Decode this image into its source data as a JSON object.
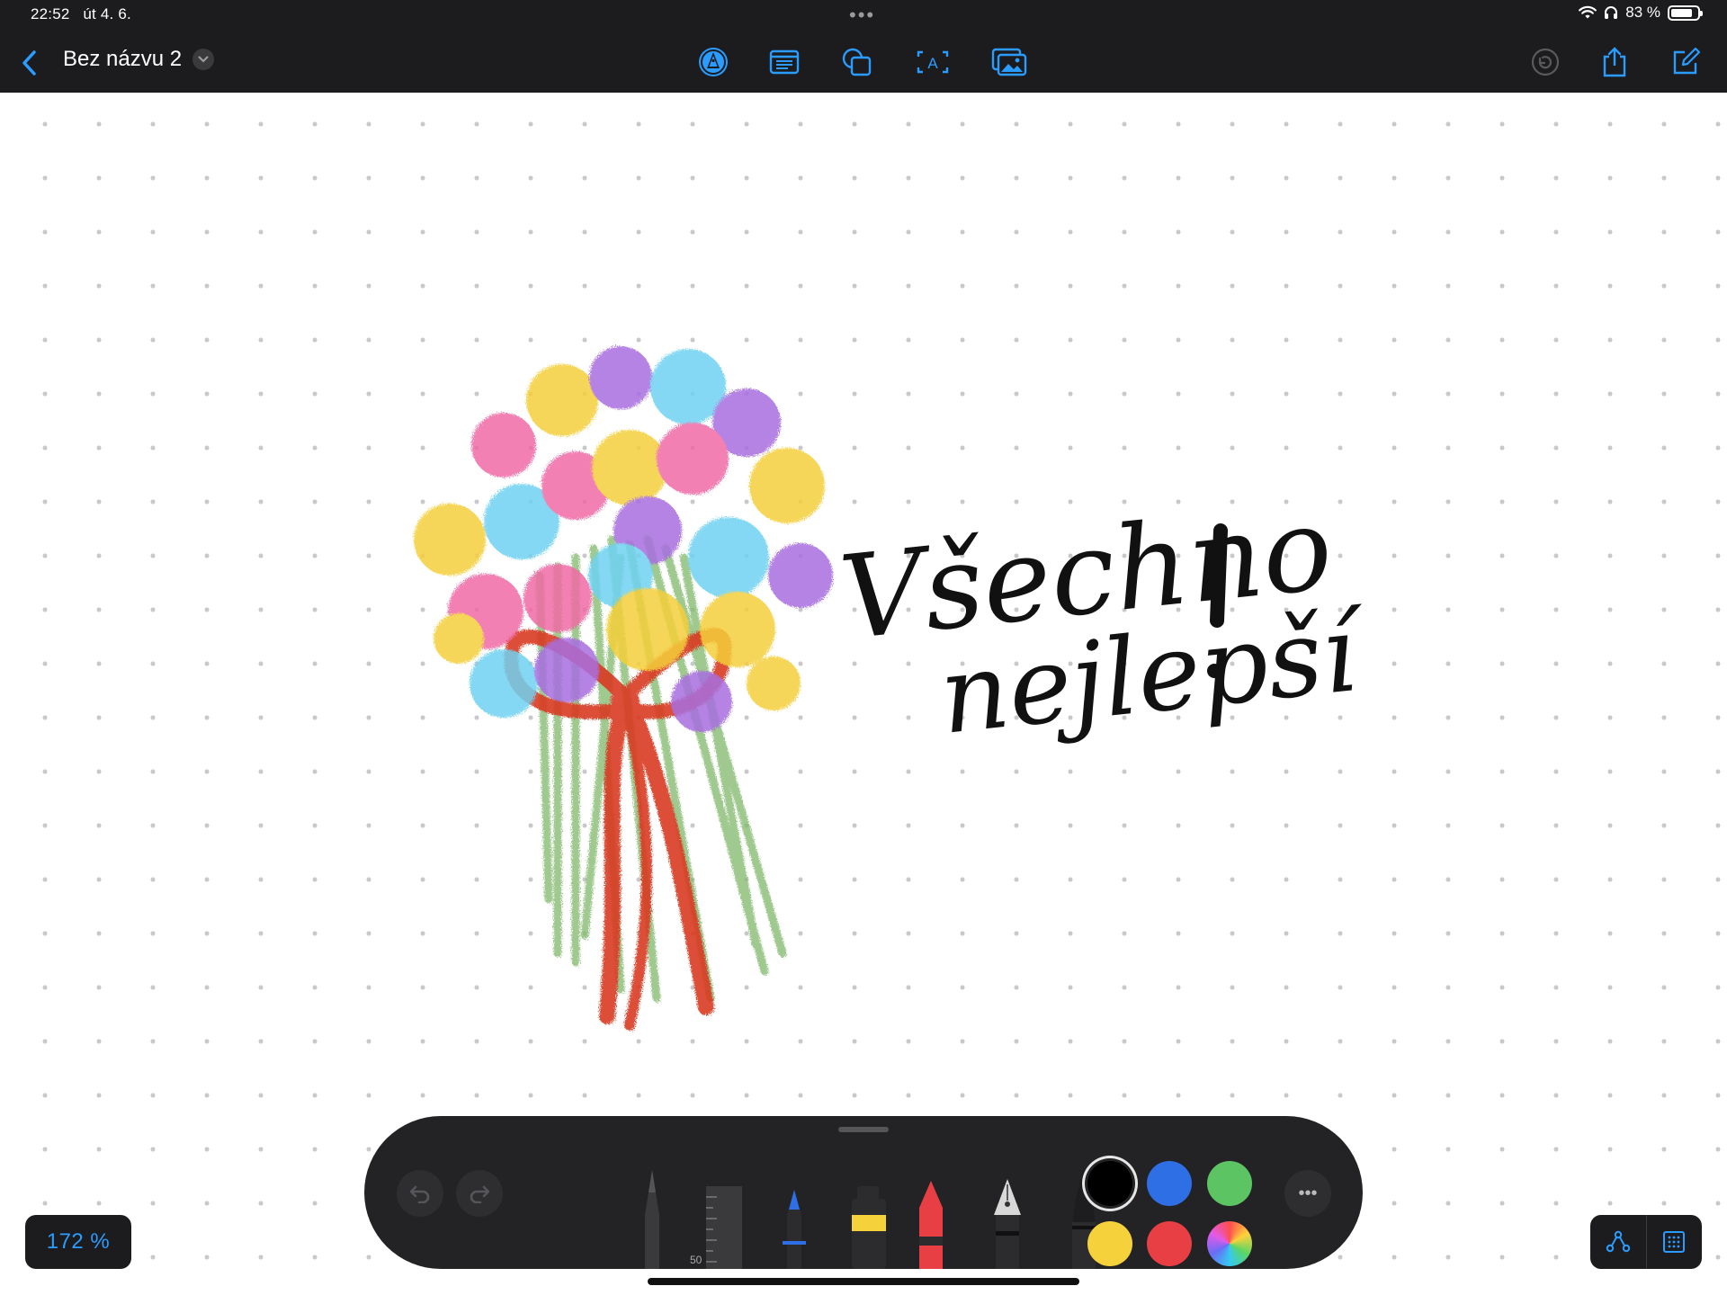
{
  "status_bar": {
    "time": "22:52",
    "date": "út 4. 6.",
    "battery_text": "83 %",
    "battery_level": 0.83,
    "multitask_dots": "•••"
  },
  "toolbar": {
    "document_title": "Bez názvu 2",
    "tools": [
      "markup-pen-icon",
      "text-box-icon",
      "shapes-icon",
      "text-icon",
      "media-icon"
    ],
    "right_tools": [
      "collaboration-icon",
      "share-icon",
      "new-board-icon"
    ]
  },
  "canvas": {
    "handwriting": "Všechno nejlepší!",
    "handwriting_line1": "Všechno",
    "handwriting_line2": "nejlepší",
    "drawing": "flower-bouquet-sketch"
  },
  "zoom": {
    "label": "172 %"
  },
  "palette": {
    "pen_size_label": "50",
    "tools": [
      "undo-button",
      "redo-button",
      "pencil-tool",
      "ruler-tool",
      "pen-tool",
      "marker-tool",
      "crayon-tool",
      "fountain-pen-tool",
      "brush-tool"
    ],
    "colors": {
      "black": "#000000",
      "blue": "#2f6fe6",
      "green": "#5cc463",
      "yellow": "#f5d23c",
      "red": "#e83f45"
    },
    "selected_color": "black",
    "more_label": "•••"
  },
  "colors": {
    "accent": "#2b9cff",
    "toolbar_bg": "#1c1c1e"
  }
}
